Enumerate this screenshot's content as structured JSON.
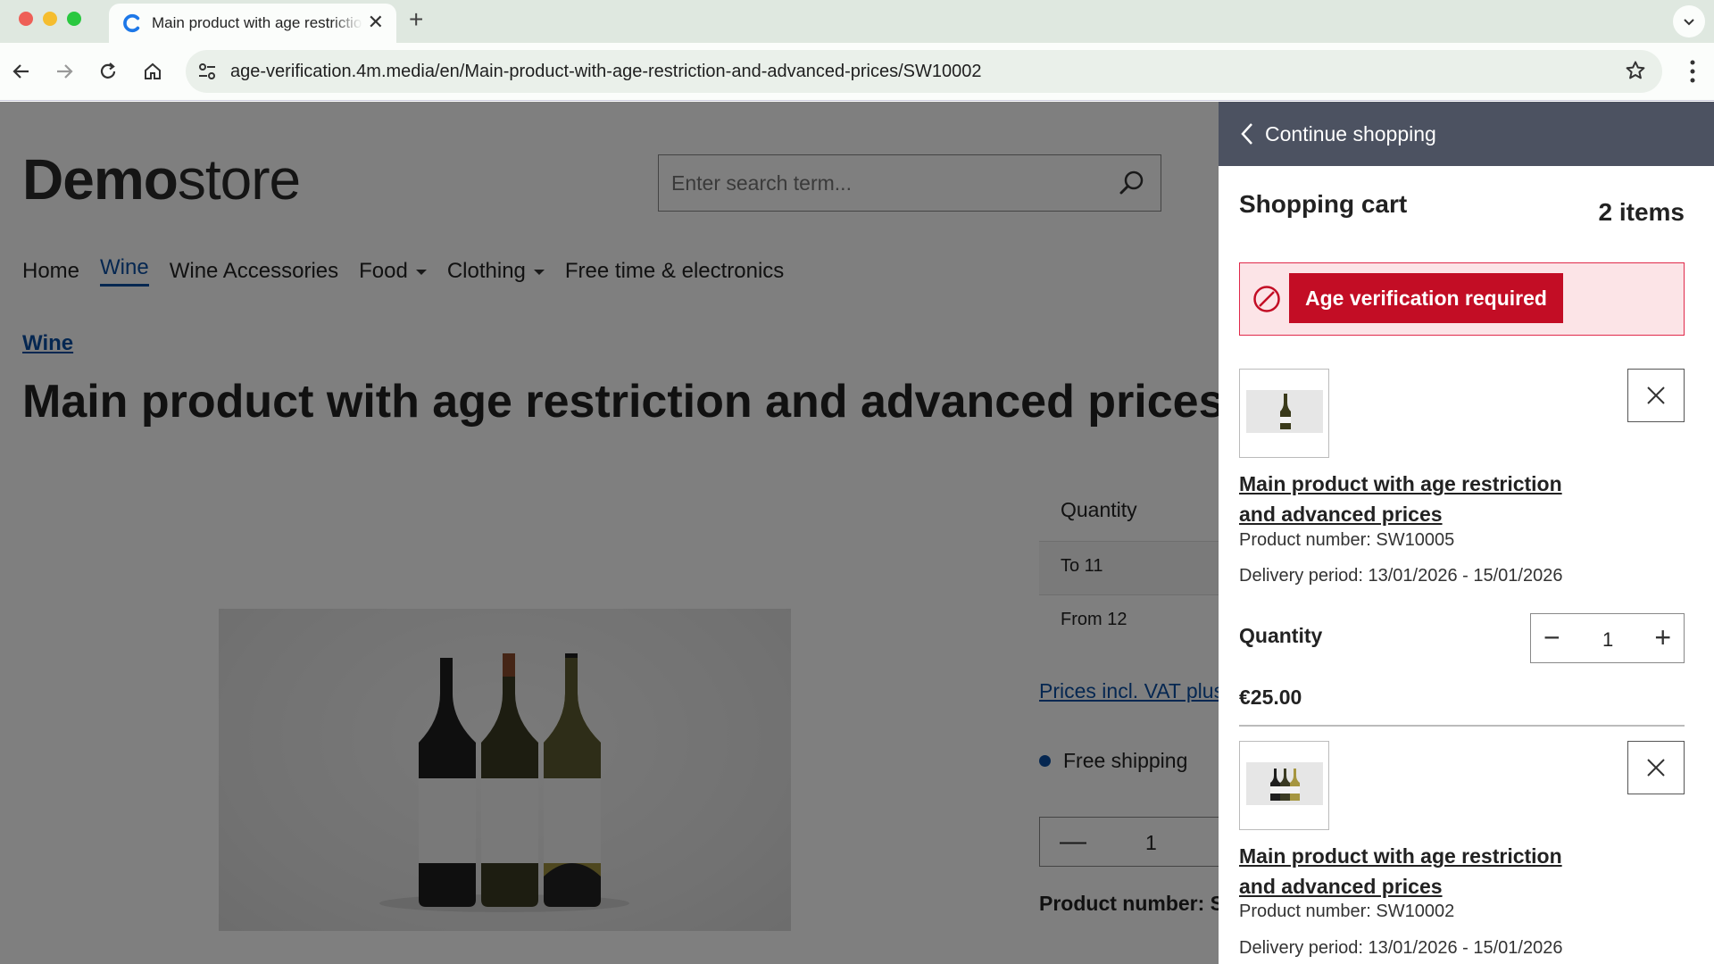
{
  "browser": {
    "tab_title": "Main product with age restrictio",
    "url": "age-verification.4m.media/en/Main-product-with-age-restriction-and-advanced-prices/SW10002"
  },
  "header": {
    "logo_bold": "Demo",
    "logo_light": "store",
    "search_placeholder": "Enter search term..."
  },
  "nav": {
    "home": "Home",
    "wine": "Wine",
    "wine_accessories": "Wine Accessories",
    "food": "Food",
    "clothing": "Clothing",
    "free_time": "Free time & electronics"
  },
  "product": {
    "breadcrumb": "Wine",
    "title": "Main product with age restriction and advanced prices",
    "quantity_header": "Quantity",
    "tiers": [
      "To 11",
      "From 12"
    ],
    "prices_link": "Prices incl. VAT plus",
    "shipping": "Free shipping",
    "quantity": "1",
    "product_number_label": "Product number: S"
  },
  "cart": {
    "continue": "Continue shopping",
    "title": "Shopping cart",
    "count": "2 items",
    "alert": "Age verification required",
    "quantity_label": "Quantity",
    "items": [
      {
        "name": "Main product with age restriction and advanced prices",
        "product_number": "Product number: SW10005",
        "delivery": "Delivery period: 13/01/2026 - 15/01/2026",
        "quantity": "1",
        "price": "€25.00"
      },
      {
        "name": "Main product with age restriction and advanced prices",
        "product_number": "Product number: SW10002",
        "delivery": "Delivery period: 13/01/2026 - 15/01/2026"
      }
    ]
  },
  "colors": {
    "link": "#0b4ea2",
    "cart_header": "#4c5261",
    "alert_bg": "#fce4e7",
    "alert_button": "#c30d25"
  }
}
